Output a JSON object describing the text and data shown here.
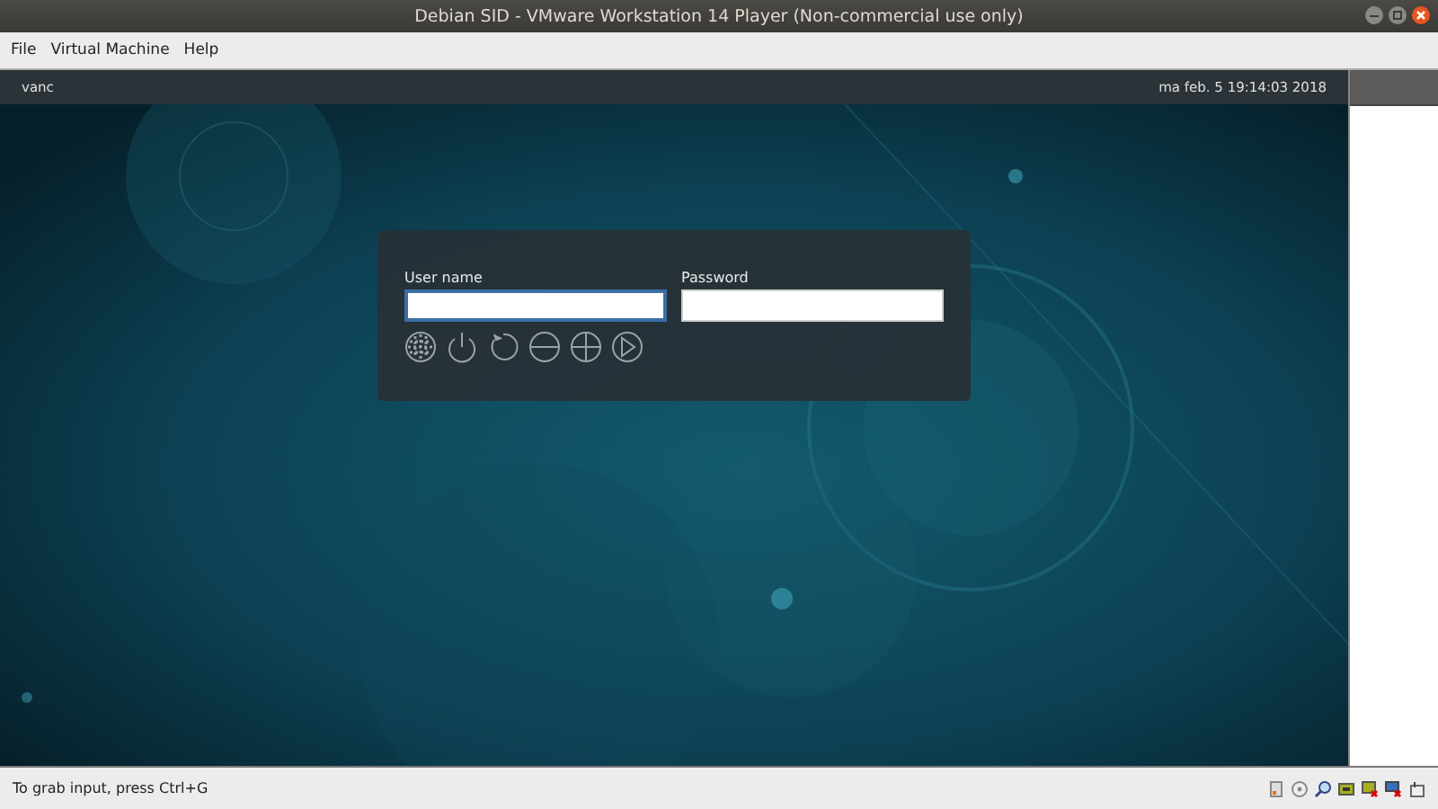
{
  "window": {
    "title": "Debian SID - VMware Workstation 14 Player (Non-commercial use only)"
  },
  "menu": [
    "File",
    "Virtual Machine",
    "Help"
  ],
  "guest_panel": {
    "user": "vanc",
    "clock": "ma feb. 5 19:14:03 2018"
  },
  "login": {
    "username": {
      "label": "User name",
      "focused": true
    },
    "password": {
      "label": "Password",
      "focused": false
    }
  },
  "status_bar": {
    "text": "To grab input, press Ctrl+G"
  }
}
